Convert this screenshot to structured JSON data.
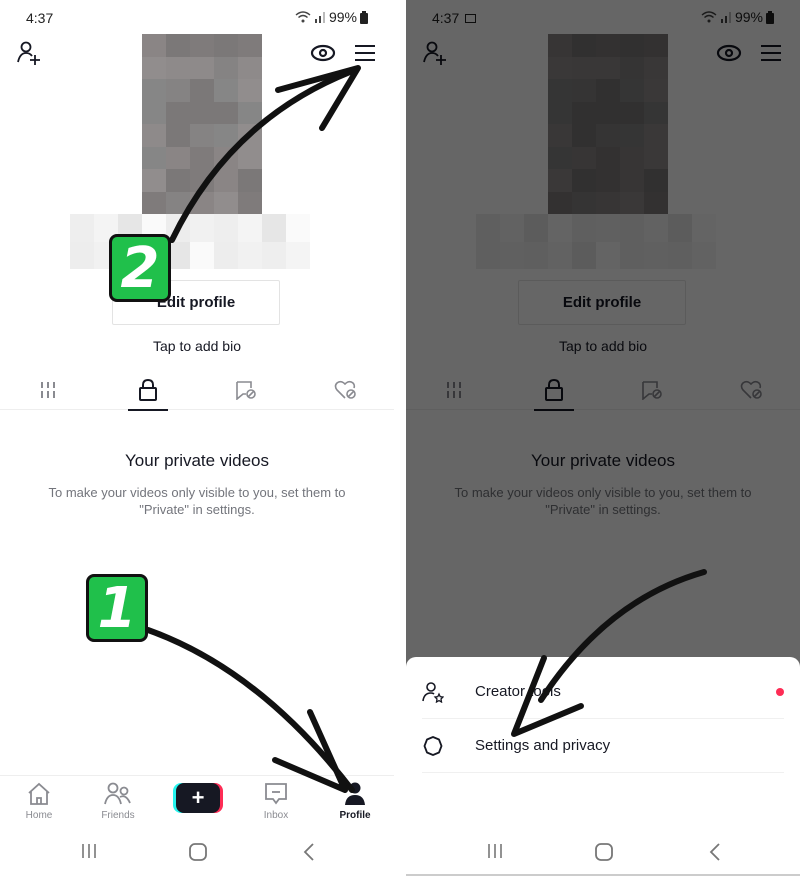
{
  "status_bar": {
    "time": "4:37",
    "battery": "99%"
  },
  "profile": {
    "edit_profile_label": "Edit profile",
    "bio_placeholder": "Tap to add bio",
    "tabs": [
      {
        "name": "videos",
        "icon": "grid-icon"
      },
      {
        "name": "private",
        "icon": "lock-icon",
        "active": true
      },
      {
        "name": "reposts",
        "icon": "repost-hidden-icon"
      },
      {
        "name": "liked",
        "icon": "liked-hidden-icon"
      }
    ],
    "empty_title": "Your private videos",
    "empty_description": "To make your videos only visible to you, set them to \"Private\" in settings."
  },
  "bottom_nav": {
    "home": "Home",
    "friends": "Friends",
    "create": "+",
    "inbox": "Inbox",
    "profile": "Profile"
  },
  "menu_sheet": {
    "items": [
      {
        "label": "Creator tools",
        "icon": "creator-tools-icon",
        "has_notification_dot": true
      },
      {
        "label": "Settings and privacy",
        "icon": "settings-icon"
      }
    ]
  },
  "annotations": {
    "step1": "1",
    "step2": "2"
  },
  "colors": {
    "accent_red": "#fe2c55",
    "accent_cyan": "#25f4ee",
    "marker_green": "#20c04b",
    "text_dark": "#161823"
  }
}
